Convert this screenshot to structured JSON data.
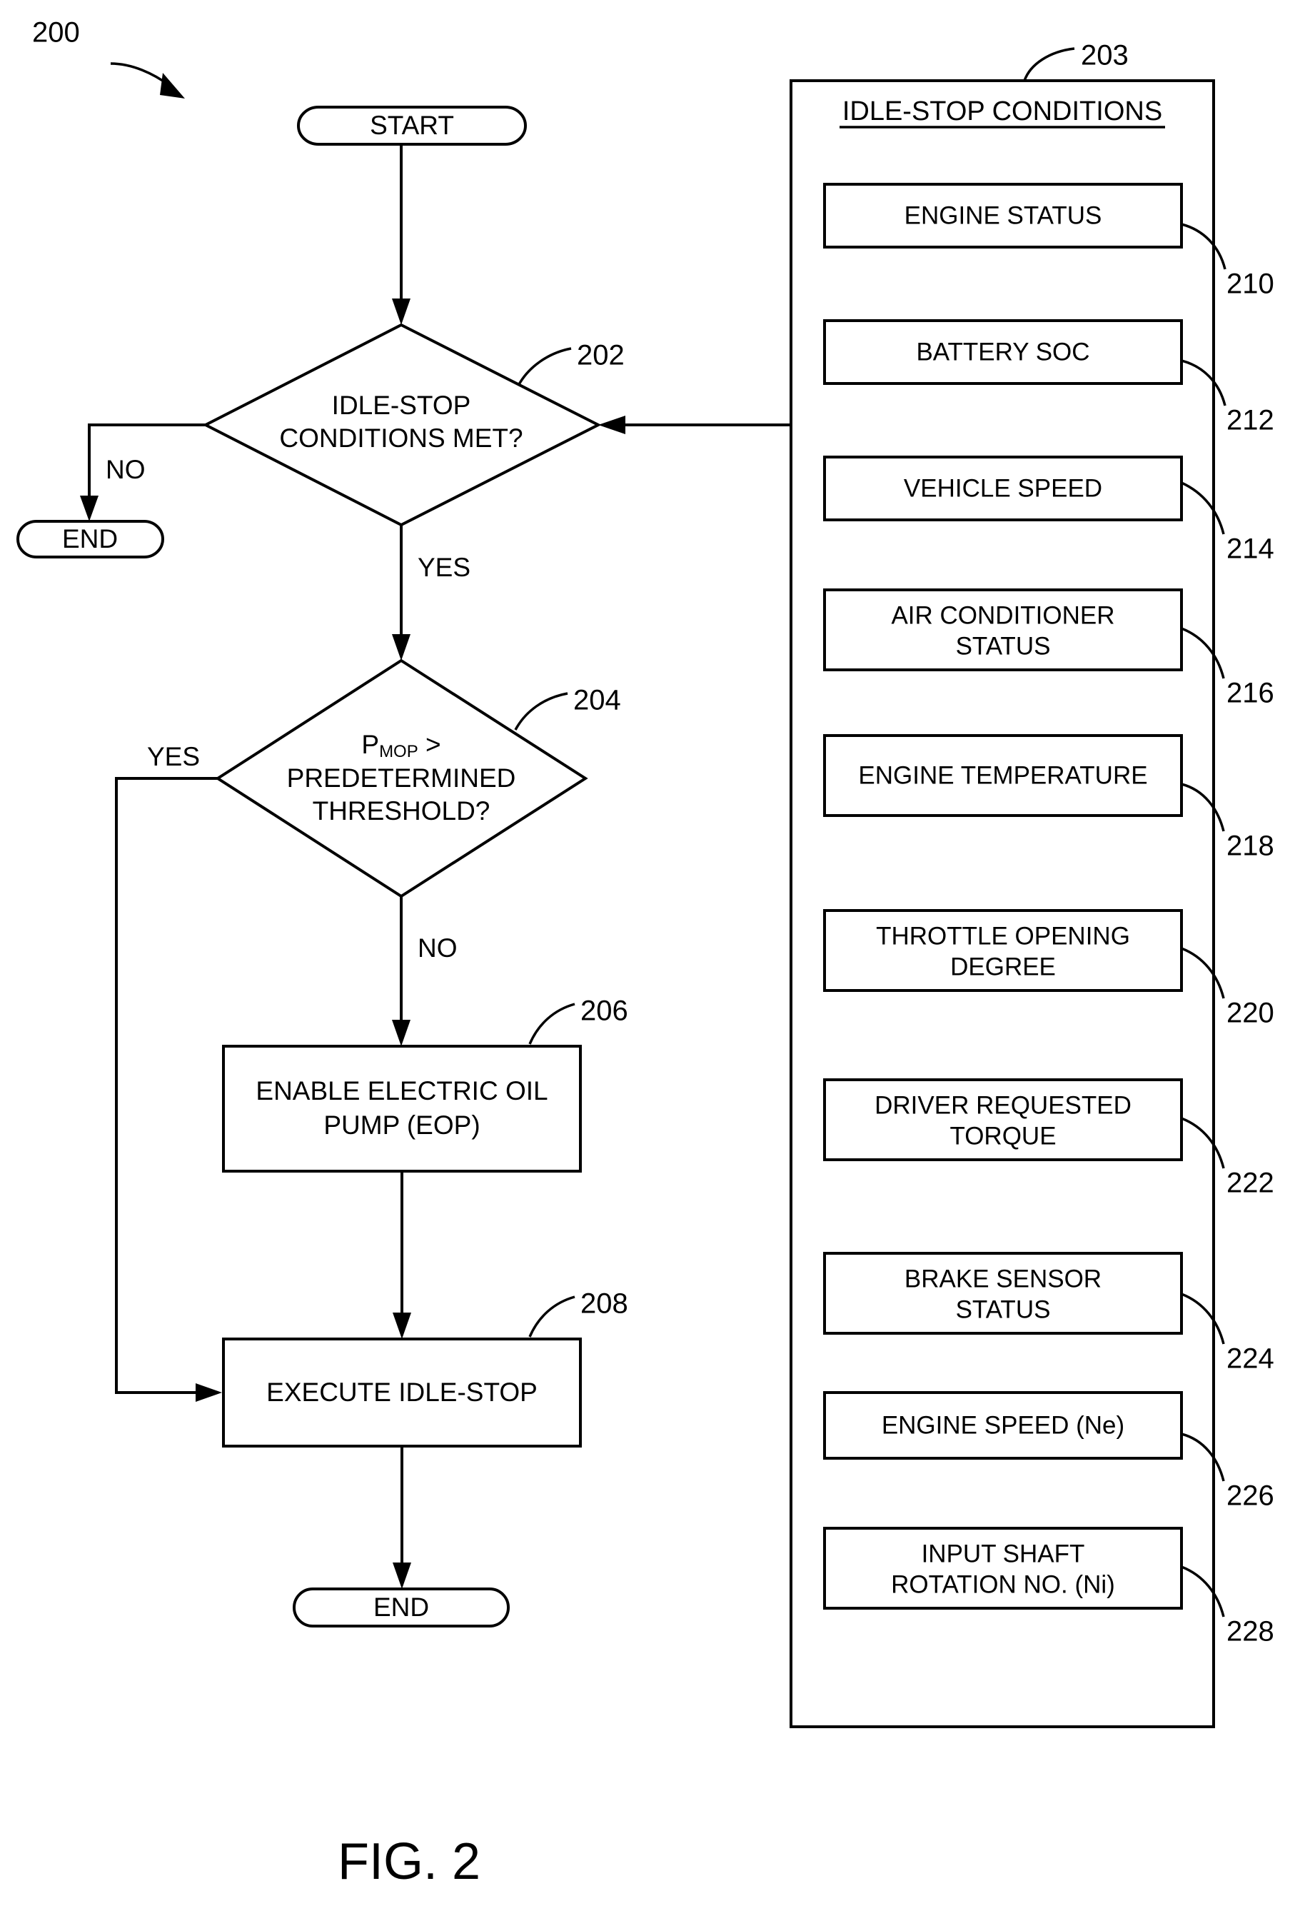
{
  "figure": {
    "caption": "FIG. 2",
    "diagram_ref": "200"
  },
  "flowchart": {
    "start_label": "START",
    "end_label_no_branch": "END",
    "end_label_final": "END",
    "decision_1": {
      "ref": "202",
      "line1": "IDLE-STOP",
      "line2": "CONDITIONS MET?",
      "branch_no": "NO",
      "branch_yes": "YES"
    },
    "decision_2": {
      "ref": "204",
      "line1_main": "P",
      "line1_sub": "MOP",
      "line1_op": " >",
      "line2": "PREDETERMINED",
      "line3": "THRESHOLD?",
      "branch_yes": "YES",
      "branch_no": "NO"
    },
    "process_1": {
      "ref": "206",
      "line1": "ENABLE ELECTRIC OIL",
      "line2": "PUMP (EOP)"
    },
    "process_2": {
      "ref": "208",
      "line1": "EXECUTE IDLE-STOP"
    }
  },
  "conditions_panel": {
    "ref": "203",
    "title": "IDLE-STOP CONDITIONS",
    "items": [
      {
        "ref": "210",
        "lines": [
          "ENGINE STATUS"
        ]
      },
      {
        "ref": "212",
        "lines": [
          "BATTERY SOC"
        ]
      },
      {
        "ref": "214",
        "lines": [
          "VEHICLE SPEED"
        ]
      },
      {
        "ref": "216",
        "lines": [
          "AIR CONDITIONER",
          "STATUS"
        ]
      },
      {
        "ref": "218",
        "lines": [
          "ENGINE TEMPERATURE"
        ]
      },
      {
        "ref": "220",
        "lines": [
          "THROTTLE OPENING",
          "DEGREE"
        ]
      },
      {
        "ref": "222",
        "lines": [
          "DRIVER REQUESTED",
          "TORQUE"
        ]
      },
      {
        "ref": "224",
        "lines": [
          "BRAKE SENSOR",
          "STATUS"
        ]
      },
      {
        "ref": "226",
        "lines": [
          "ENGINE SPEED (Ne)"
        ]
      },
      {
        "ref": "228",
        "lines": [
          "INPUT SHAFT",
          "ROTATION NO. (Ni)"
        ]
      }
    ]
  },
  "colors": {
    "ink": "#000000",
    "paper": "#ffffff"
  }
}
